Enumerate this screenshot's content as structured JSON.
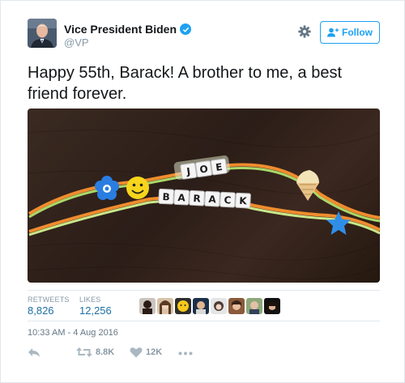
{
  "user": {
    "display_name": "Vice President Biden",
    "handle": "@VP",
    "verified": true
  },
  "follow_button": {
    "label": "Follow"
  },
  "tweet": {
    "text": "Happy 55th, Barack! A brother to me, a best friend forever."
  },
  "photo": {
    "beads_top": [
      "J",
      "O",
      "E"
    ],
    "beads_bottom": [
      "B",
      "A",
      "R",
      "A",
      "C",
      "K"
    ]
  },
  "stats": {
    "retweets_label": "RETWEETS",
    "retweets_value": "8,826",
    "likes_label": "LIKES",
    "likes_value": "12,256"
  },
  "timestamp": "10:33 AM - 4 Aug 2016",
  "actions": {
    "retweet_count": "8.8K",
    "like_count": "12K"
  },
  "colors": {
    "brand_blue": "#1da1f2",
    "stat_blue": "#1d6fa5",
    "muted_gray": "#8899a6"
  }
}
